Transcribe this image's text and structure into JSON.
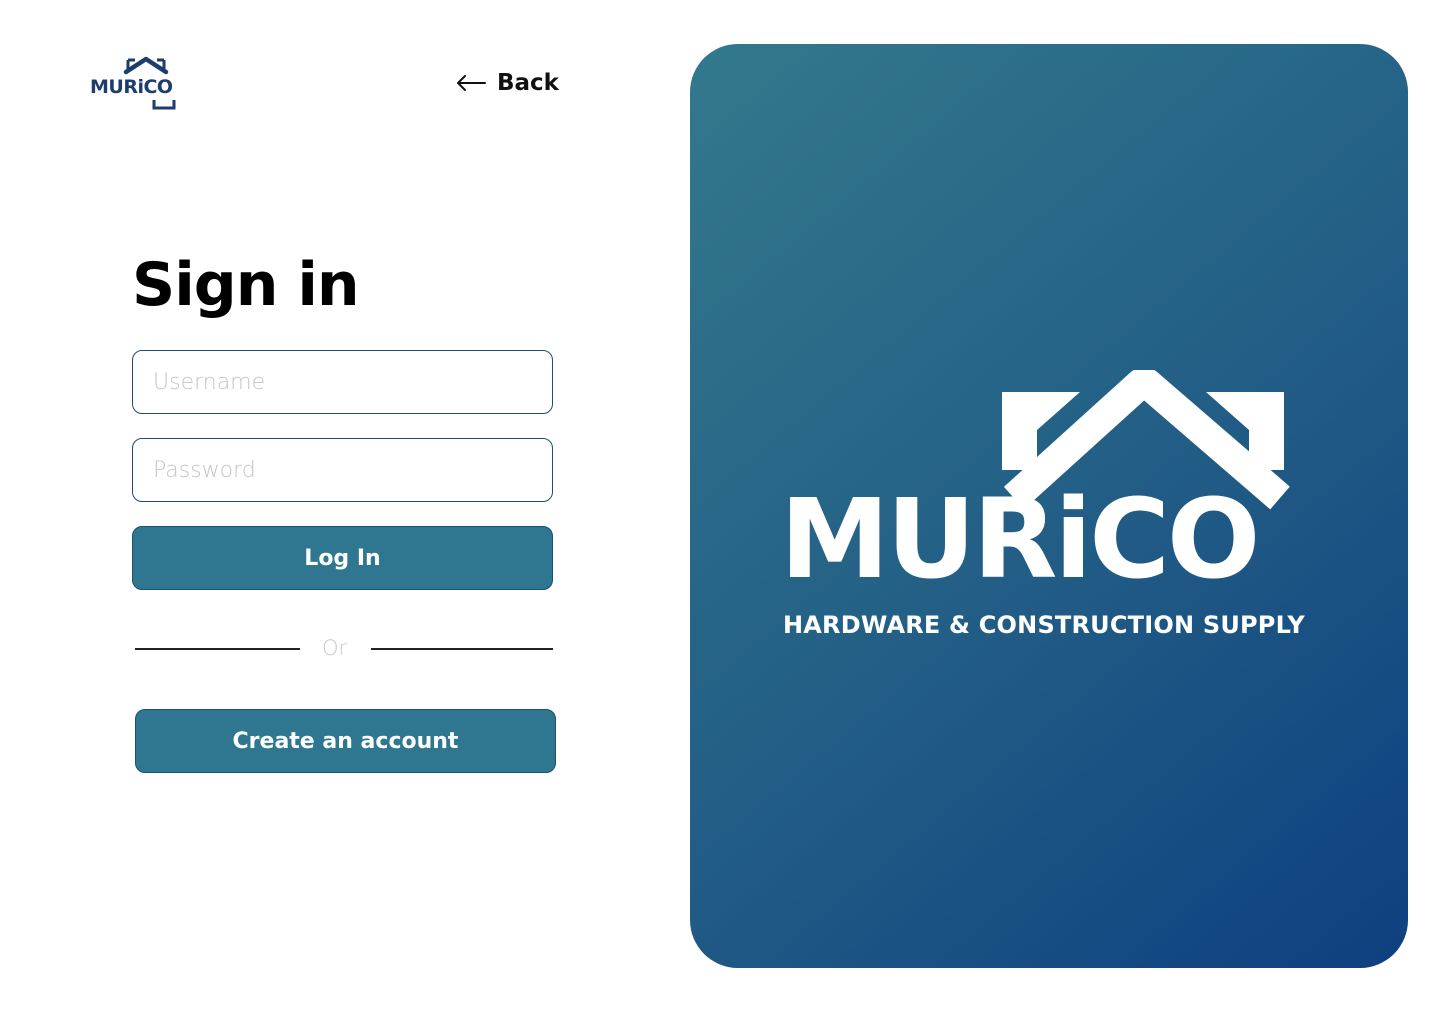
{
  "brand": {
    "logo_text": "MURiCO",
    "tagline": "HARDWARE & CONSTRUCTION SUPPLY",
    "primary_color": "#2f7790",
    "dark_color": "#1d3d6f"
  },
  "nav": {
    "back_label": "Back",
    "back_icon": "arrow-left-icon"
  },
  "signin": {
    "title": "Sign in",
    "username_placeholder": "Username",
    "password_placeholder": "Password",
    "login_label": "Log In",
    "divider_text": "Or",
    "create_account_label": "Create an account"
  }
}
